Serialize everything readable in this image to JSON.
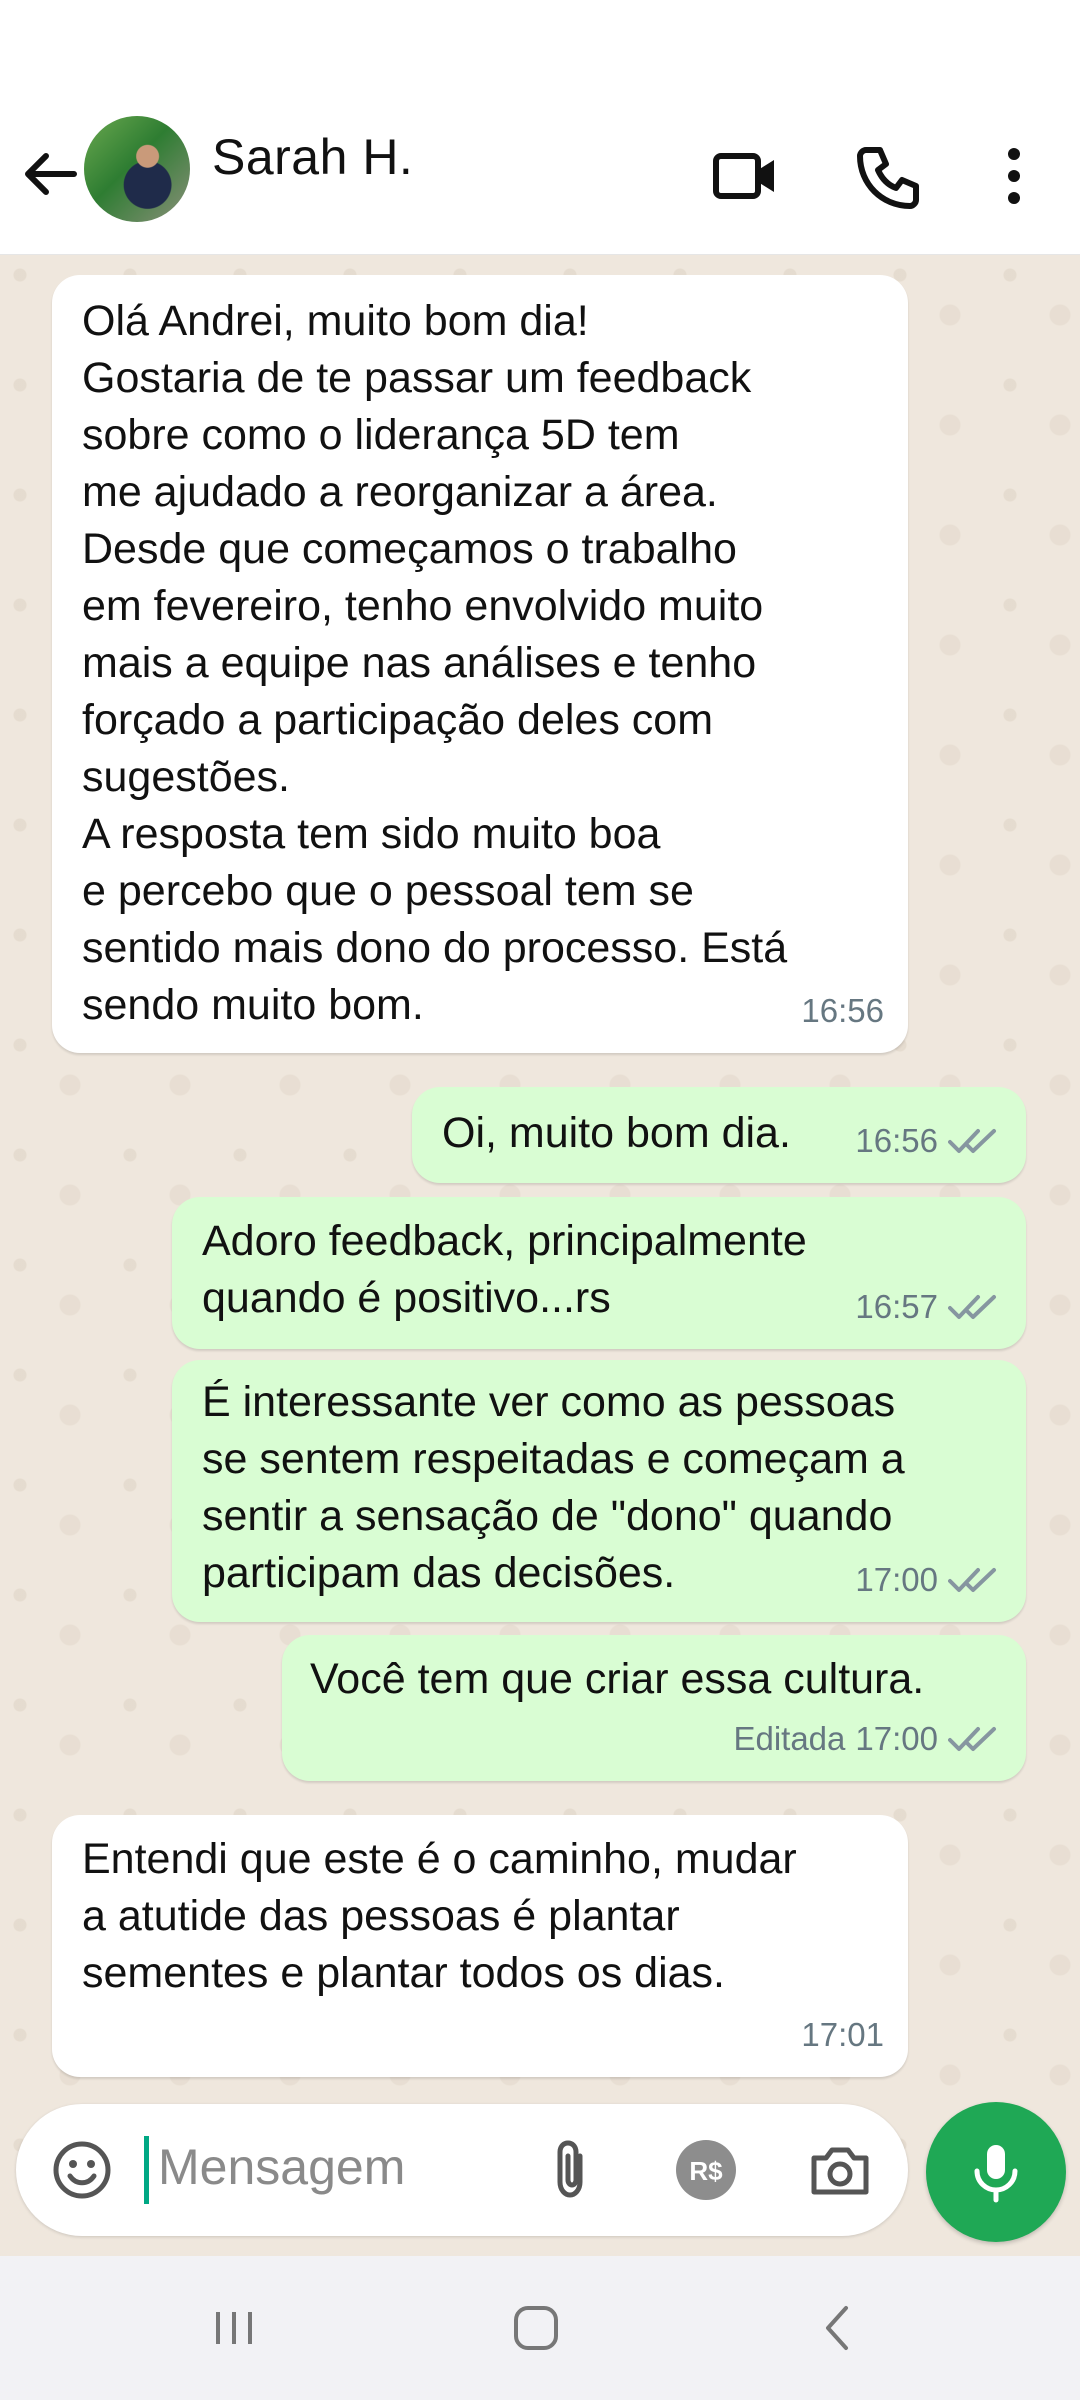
{
  "header": {
    "contact_name": "Sarah H.",
    "icons": [
      "back-arrow-icon",
      "video-call-icon",
      "voice-call-icon",
      "more-options-icon"
    ]
  },
  "messages": [
    {
      "direction": "incoming",
      "text": "Olá Andrei, muito bom dia!\nGostaria de te passar um feedback\nsobre como o liderança 5D tem\nme ajudado a reorganizar a área.\nDesde que começamos o trabalho\nem fevereiro, tenho envolvido muito\nmais a equipe nas análises e tenho\nforçado a participação deles com\nsugestões.\nA resposta tem sido muito boa\ne percebo que o pessoal tem se\nsentido mais dono do processo. Está\nsendo muito bom.",
      "time": "16:56"
    },
    {
      "direction": "outgoing",
      "text": "Oi, muito bom dia.",
      "time": "16:56"
    },
    {
      "direction": "outgoing",
      "text": "Adoro feedback,  principalmente\nquando é positivo...rs",
      "time": "16:57"
    },
    {
      "direction": "outgoing",
      "text": "É interessante ver como as pessoas\nse sentem respeitadas e começam a\nsentir a sensação de \"dono\" quando\nparticipam das decisões.",
      "time": "17:00"
    },
    {
      "direction": "outgoing",
      "text": "Você tem que criar essa cultura.",
      "time": "17:00",
      "edited_label": "Editada"
    },
    {
      "direction": "incoming",
      "text": "Entendi que este é o caminho, mudar\na atutide  das pessoas é plantar\nsementes e plantar todos os dias.",
      "time": "17:01"
    }
  ],
  "input": {
    "placeholder": "Mensagem",
    "icons": [
      "emoji-icon",
      "attach-icon",
      "payment-icon",
      "camera-icon",
      "mic-icon"
    ]
  },
  "colors": {
    "outgoing_bubble": "#d9fdd3",
    "incoming_bubble": "#ffffff",
    "chat_background": "#efe7dd",
    "accent": "#1fa855"
  }
}
